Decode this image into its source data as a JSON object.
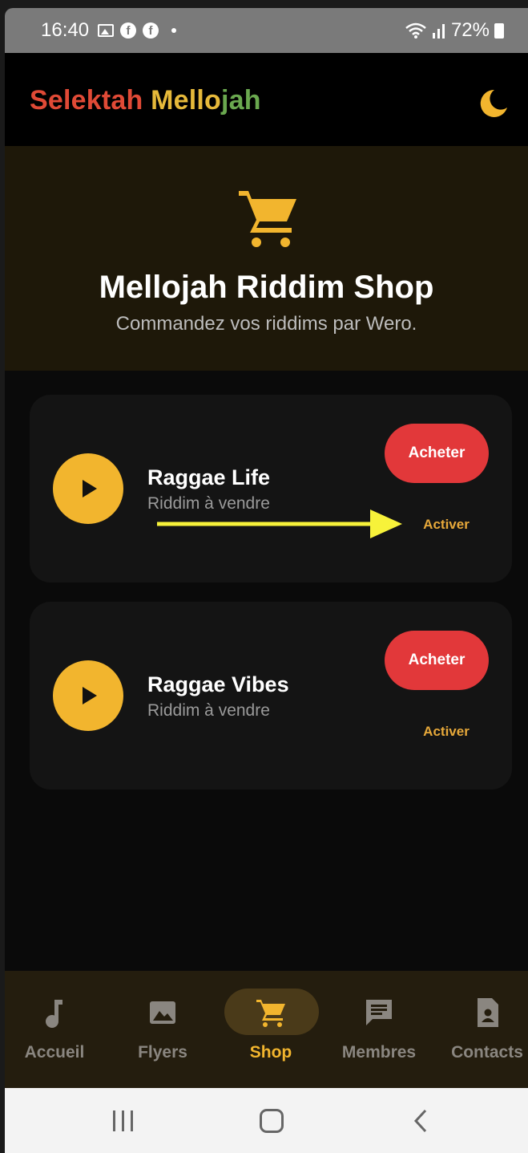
{
  "status_bar": {
    "time": "16:40",
    "battery": "72%",
    "icons": [
      "gallery-icon",
      "facebook-icon",
      "facebook-icon",
      "dot-icon",
      "wifi-icon",
      "signal-icon",
      "battery-icon"
    ]
  },
  "header": {
    "brand_part1": "Selektah",
    "brand_part2": "Mello",
    "brand_part3": "jah",
    "theme_icon": "moon-icon"
  },
  "hero": {
    "icon": "cart-icon",
    "title": "Mellojah Riddim Shop",
    "subtitle": "Commandez vos riddims par Wero."
  },
  "products": [
    {
      "title": "Raggae Life",
      "subtitle": "Riddim à vendre",
      "buy_label": "Acheter",
      "activate_label": "Activer"
    },
    {
      "title": "Raggae Vibes",
      "subtitle": "Riddim à vendre",
      "buy_label": "Acheter",
      "activate_label": "Activer"
    }
  ],
  "bottom_nav": [
    {
      "label": "Accueil",
      "icon": "music-note-icon",
      "active": false
    },
    {
      "label": "Flyers",
      "icon": "image-icon",
      "active": false
    },
    {
      "label": "Shop",
      "icon": "cart-icon",
      "active": true
    },
    {
      "label": "Membres",
      "icon": "chat-icon",
      "active": false
    },
    {
      "label": "Contacts",
      "icon": "contact-icon",
      "active": false
    }
  ],
  "colors": {
    "accent": "#f2b52e",
    "buy": "#e2383a",
    "brand_red": "#e04a36",
    "brand_yellow": "#e6b93a",
    "brand_green": "#6aa84f",
    "annotation_arrow": "#f7f23a"
  }
}
